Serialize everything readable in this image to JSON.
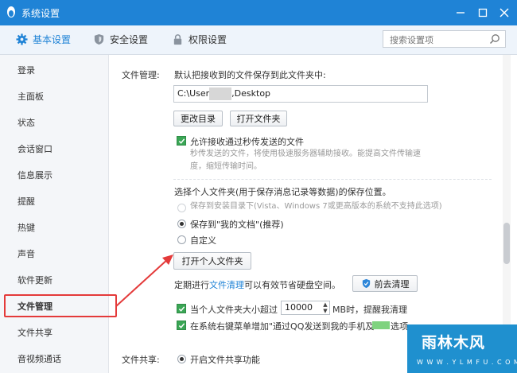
{
  "window": {
    "title": "系统设置"
  },
  "tabs": [
    {
      "label": "基本设置",
      "icon": "gear-icon"
    },
    {
      "label": "安全设置",
      "icon": "shield-icon"
    },
    {
      "label": "权限设置",
      "icon": "lock-icon"
    }
  ],
  "search": {
    "placeholder": "搜索设置项"
  },
  "sidebar": {
    "items": [
      {
        "label": "登录"
      },
      {
        "label": "主面板"
      },
      {
        "label": "状态"
      },
      {
        "label": "会话窗口"
      },
      {
        "label": "信息展示"
      },
      {
        "label": "提醒"
      },
      {
        "label": "热键"
      },
      {
        "label": "声音"
      },
      {
        "label": "软件更新"
      },
      {
        "label": "文件管理"
      },
      {
        "label": "文件共享"
      },
      {
        "label": "音视频通话"
      }
    ],
    "selected": "文件管理"
  },
  "file_mgmt": {
    "section_label": "文件管理:",
    "save_heading": "默认把接收到的文件保存到此文件夹中:",
    "path_prefix": "C:\\User",
    "path_suffix": ",Desktop",
    "change_dir_button": "更改目录",
    "open_folder_button": "打开文件夹",
    "allow_fast_label": "允许接收通过秒传发送的文件",
    "allow_fast_desc_1": "秒传发送的文件，将使用极速服务器辅助接收。能提高文件传输速",
    "allow_fast_desc_2": "度，缩短传输时间。",
    "personal_folder_heading": "选择个人文件夹(用于保存消息记录等数据)的保存位置。",
    "radio_install_dir": "保存到安装目录下(Vista、Windows 7或更高版本的系统不支持此选项)",
    "radio_my_docs": "保存到\"我的文档\"(推荐)",
    "radio_custom": "自定义",
    "open_personal_button": "打开个人文件夹",
    "cleanup_prefix": "定期进行",
    "cleanup_link": "文件清理",
    "cleanup_suffix": "可以有效节省硬盘空间。",
    "cleanup_button": "前去清理",
    "size_limit_prefix": "当个人文件夹大小超过",
    "size_limit_value": "10000",
    "size_limit_suffix": "MB时，提醒我清理",
    "context_menu_label": "在系统右键菜单增加\"通过QQ发送到我的手机及",
    "context_menu_tail": "选项"
  },
  "file_share": {
    "section_label": "文件共享:",
    "enable_label": "开启文件共享功能"
  },
  "watermark": {
    "brand": "雨林木风",
    "url": "W W W . Y L M F U . C O M"
  },
  "colors": {
    "titlebar": "#1f83d6",
    "accent": "#1f83d6",
    "checkbox": "#3aa655",
    "highlight": "#e43a3a",
    "watermark_bg": "#1f90cf"
  }
}
